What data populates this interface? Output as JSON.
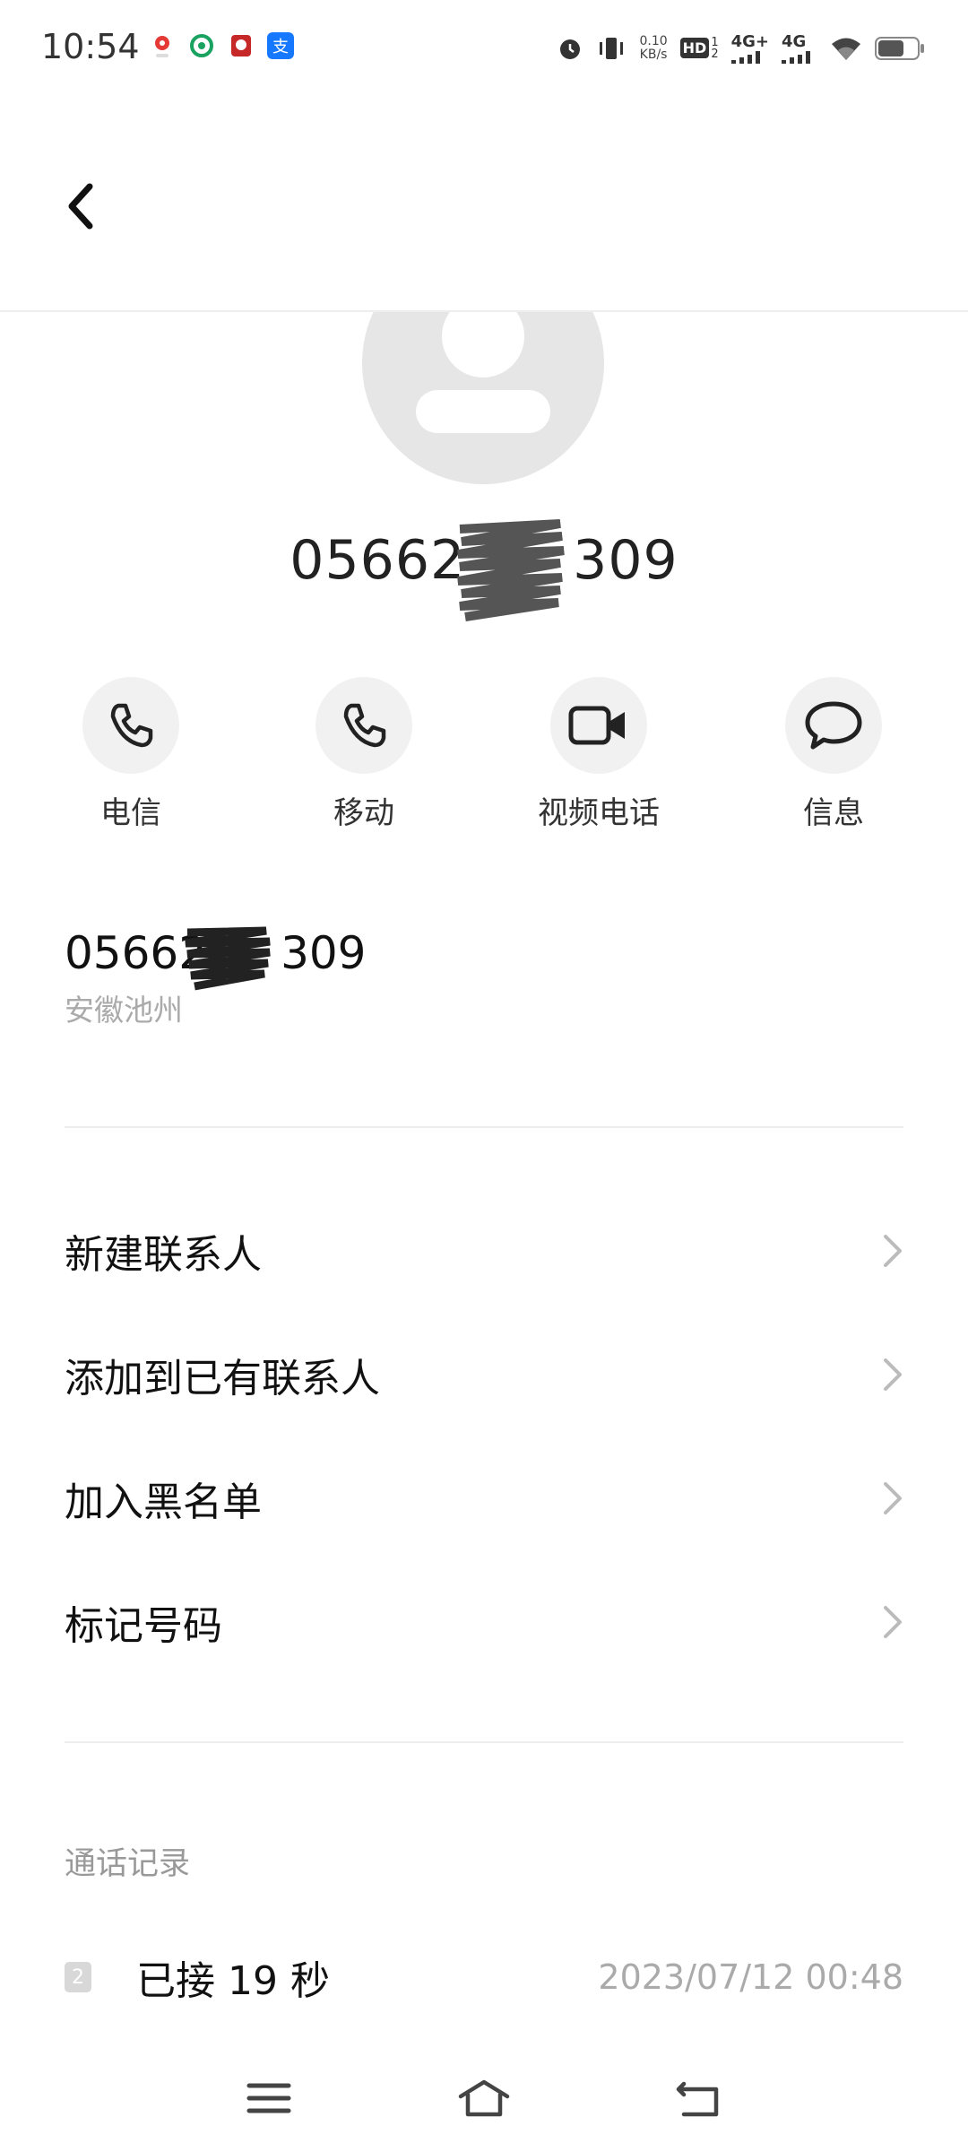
{
  "status_bar": {
    "time": "10:54",
    "net_speed_value": "0.10",
    "net_speed_unit": "KB/s",
    "hd_label": "HD",
    "sim1_label": "1",
    "sim2_label": "2",
    "net1_type": "4G+",
    "net2_type": "4G"
  },
  "contact": {
    "number_visible_prefix": "05662",
    "number_visible_suffix": "309"
  },
  "actions": [
    {
      "label": "电信",
      "icon": "phone-icon"
    },
    {
      "label": "移动",
      "icon": "phone-icon"
    },
    {
      "label": "视频电话",
      "icon": "video-camera-icon"
    },
    {
      "label": "信息",
      "icon": "message-icon"
    }
  ],
  "number_info": {
    "number_prefix": "05662",
    "number_suffix": "309",
    "location": "安徽池州"
  },
  "menu_items": [
    {
      "label": "新建联系人"
    },
    {
      "label": "添加到已有联系人"
    },
    {
      "label": "加入黑名单"
    },
    {
      "label": "标记号码"
    }
  ],
  "call_log": {
    "title": "通话记录",
    "sim_badge": "2",
    "entries": [
      {
        "desc": "已接 19 秒",
        "time": "2023/07/12 00:48"
      }
    ]
  },
  "colors": {
    "avatar_bg": "#e6e6e6",
    "action_bg": "#f1f1f1",
    "secondary_text": "#aaaaaa"
  }
}
